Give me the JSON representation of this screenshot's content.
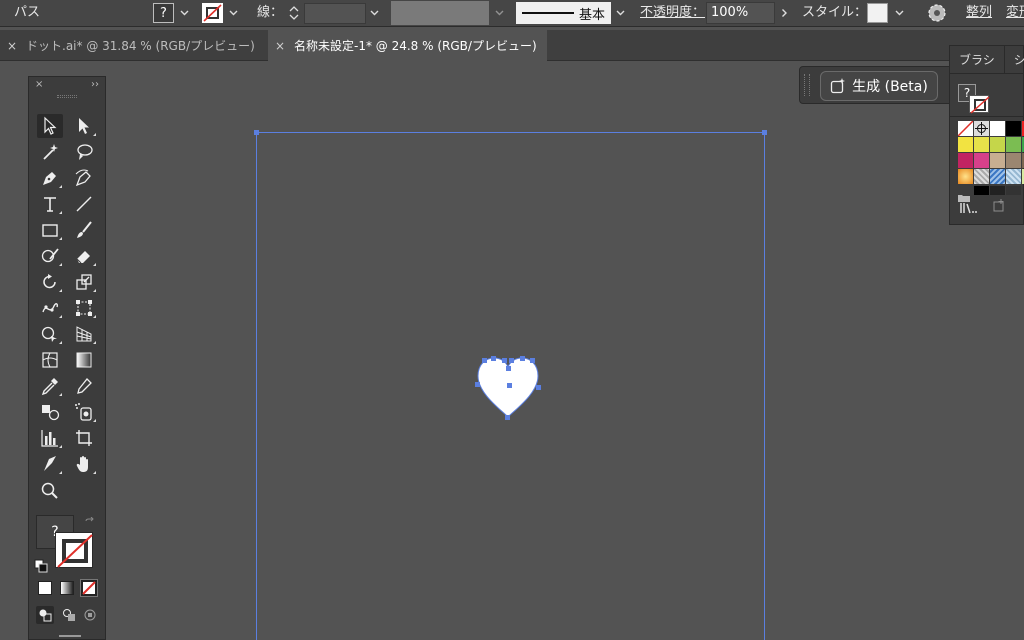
{
  "control_bar": {
    "selection_type": "パス",
    "fill_value": "?",
    "stroke_label": "線：",
    "stroke_profile_label": "基本",
    "opacity_label": "不透明度：",
    "opacity_value": "100%",
    "style_label": "スタイル：",
    "align_label": "整列",
    "transform_label": "変形"
  },
  "tabs": [
    {
      "label": "ドット.ai* @ 31.84 % (RGB/プレビュー)",
      "active": false
    },
    {
      "label": "名称未設定-1* @ 24.8 % (RGB/プレビュー)",
      "active": true
    }
  ],
  "toolbar": {
    "collapse_glyph": "››",
    "close_glyph": "×",
    "fill_swatch_value": "?"
  },
  "generate_button": {
    "label": "生成 (Beta)"
  },
  "right_panel": {
    "tabs": [
      "ブラシ",
      "シ"
    ],
    "fill_value": "?"
  },
  "colors": {
    "accent_selection": "#5b7fe0",
    "canvas": "#535353",
    "panel": "#3c3c3c",
    "none_stroke": "#e0302a"
  }
}
